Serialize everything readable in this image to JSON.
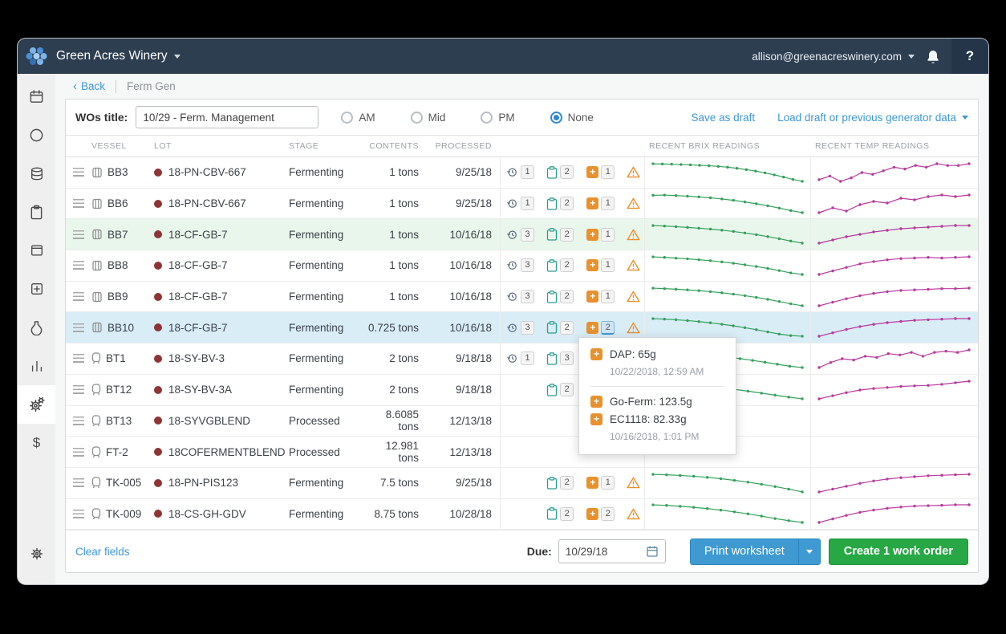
{
  "colors": {
    "navbar_bg": "#2d3e50",
    "link_blue": "#3e97d3",
    "brix_line": "#33a05a",
    "temp_line": "#b93a9e",
    "addition_orange": "#e8912d",
    "warning_orange": "#e8912d",
    "lot_dot": "#8e3434",
    "print_button_blue": "#3f9ad2",
    "create_button_green": "#28a745",
    "row_highlight_green": "#e9f6ec",
    "row_highlight_blue": "#d9edf7"
  },
  "navbar": {
    "title": "Green Acres Winery",
    "user_email": "allison@greenacreswinery.com",
    "help_label": "?"
  },
  "sidebar": {
    "items": [
      {
        "name": "calendar",
        "active": false
      },
      {
        "name": "circle",
        "active": false
      },
      {
        "name": "tanks",
        "active": false
      },
      {
        "name": "clipboard",
        "active": false
      },
      {
        "name": "bin",
        "active": false
      },
      {
        "name": "add",
        "active": false
      },
      {
        "name": "carboy",
        "active": false
      },
      {
        "name": "chart",
        "active": false
      },
      {
        "name": "gears",
        "active": true
      },
      {
        "name": "dollar",
        "active": false
      },
      {
        "name": "settings",
        "active": false,
        "bottom": true
      }
    ]
  },
  "breadcrumb": {
    "back_label": "Back",
    "page_label": "Ferm Gen"
  },
  "form": {
    "wos_title_label": "WOs title:",
    "wos_title_value": "10/29 - Ferm. Management",
    "radios": [
      {
        "label": "AM",
        "selected": false
      },
      {
        "label": "Mid",
        "selected": false
      },
      {
        "label": "PM",
        "selected": false
      },
      {
        "label": "None",
        "selected": true
      }
    ],
    "save_as_draft_label": "Save as draft",
    "load_draft_label": "Load draft or previous generator data"
  },
  "table": {
    "headers": {
      "vessel": "VESSEL",
      "lot": "LOT",
      "stage": "STAGE",
      "contents": "CONTENTS",
      "processed": "PROCESSED",
      "brix": "RECENT BRIX READINGS",
      "temp": "RECENT TEMP READINGS"
    },
    "rows": [
      {
        "vessel": "BB3",
        "vessel_icon": "barrel",
        "lot": "18-PN-CBV-667",
        "stage": "Fermenting",
        "contents": "1 tons",
        "processed": "9/25/18",
        "history": 1,
        "notes": 2,
        "additions": 1,
        "additions_active": false,
        "warning": true,
        "highlight": "",
        "brix": [
          23.8,
          23.6,
          23.4,
          23.1,
          22.8,
          22.4,
          22,
          21.4,
          20.6,
          19.6,
          18.4,
          17,
          15.4,
          13.6,
          11.6,
          9.4,
          7.6
        ],
        "temp": [
          66,
          68,
          65,
          67,
          70,
          69,
          71,
          73,
          72,
          74,
          73,
          75,
          74,
          74,
          75
        ]
      },
      {
        "vessel": "BB6",
        "vessel_icon": "barrel",
        "lot": "18-PN-CBV-667",
        "stage": "Fermenting",
        "contents": "1 tons",
        "processed": "9/25/18",
        "history": 1,
        "notes": 2,
        "additions": 1,
        "additions_active": false,
        "warning": true,
        "highlight": "",
        "brix": [
          22.6,
          22.8,
          22.3,
          21.8,
          21.2,
          20.4,
          19.4,
          18.2,
          16.8,
          15.2,
          13.4,
          11.4,
          9.2,
          7.4
        ],
        "temp": [
          63,
          66,
          64,
          68,
          70,
          69,
          72,
          71,
          73,
          74,
          73,
          74
        ]
      },
      {
        "vessel": "BB7",
        "vessel_icon": "barrel",
        "lot": "18-CF-GB-7",
        "stage": "Fermenting",
        "contents": "1 tons",
        "processed": "10/16/18",
        "history": 3,
        "notes": 2,
        "additions": 1,
        "additions_active": false,
        "warning": true,
        "highlight": "green",
        "brix": [
          21.5,
          21,
          20.4,
          19.7,
          18.9,
          18,
          16.9,
          15.6,
          14.1,
          12.4,
          10.5,
          8.4,
          6.1,
          4
        ],
        "temp": [
          60,
          62,
          64,
          65.5,
          67,
          68,
          69,
          69.5,
          70,
          70.5,
          71,
          71
        ]
      },
      {
        "vessel": "BB8",
        "vessel_icon": "barrel",
        "lot": "18-CF-GB-7",
        "stage": "Fermenting",
        "contents": "1 tons",
        "processed": "10/16/18",
        "history": 3,
        "notes": 2,
        "additions": 1,
        "additions_active": false,
        "warning": true,
        "highlight": "",
        "brix": [
          21.8,
          21.2,
          20.5,
          19.7,
          18.8,
          17.8,
          16.6,
          15.2,
          13.6,
          11.8,
          9.8,
          7.6,
          5.2,
          3.6
        ],
        "temp": [
          58,
          61,
          64,
          67,
          69,
          70.5,
          71.5,
          72,
          72.5,
          72,
          72.5,
          73
        ]
      },
      {
        "vessel": "BB9",
        "vessel_icon": "barrel",
        "lot": "18-CF-GB-7",
        "stage": "Fermenting",
        "contents": "1 tons",
        "processed": "10/16/18",
        "history": 3,
        "notes": 2,
        "additions": 1,
        "additions_active": false,
        "warning": true,
        "highlight": "",
        "brix": [
          22.4,
          21.9,
          21.3,
          20.6,
          19.8,
          18.8,
          17.6,
          16.2,
          14.6,
          12.8,
          10.8,
          8.6,
          6.2,
          4.2
        ],
        "temp": [
          59,
          62,
          65,
          67.5,
          69.5,
          71,
          72,
          72.5,
          73,
          73.5,
          73.5,
          74
        ]
      },
      {
        "vessel": "BB10",
        "vessel_icon": "barrel",
        "lot": "18-CF-GB-7",
        "stage": "Fermenting",
        "contents": "0.725 tons",
        "processed": "10/16/18",
        "history": 3,
        "notes": 2,
        "additions": 2,
        "additions_active": true,
        "warning": true,
        "highlight": "blue",
        "brix": [
          20.6,
          20.1,
          19.5,
          18.7,
          17.7,
          16.5,
          15.1,
          13.5,
          11.7,
          9.7,
          7.5,
          5.3,
          3.8,
          3.2
        ],
        "temp": [
          57,
          60,
          63,
          65.5,
          67.5,
          69,
          70,
          71,
          71.5,
          72,
          72.5,
          72.5
        ]
      },
      {
        "vessel": "BT1",
        "vessel_icon": "tank",
        "lot": "18-SY-BV-3",
        "stage": "Fermenting",
        "contents": "2 tons",
        "processed": "9/18/18",
        "history": 1,
        "notes": 3,
        "additions": null,
        "additions_active": false,
        "warning": false,
        "highlight": "",
        "brix": [
          18.5,
          17.8,
          17,
          16.1,
          15.1,
          14,
          12.8,
          11.5,
          10.1,
          8.6,
          7,
          5.4,
          4.4
        ],
        "temp": [
          62,
          66,
          69,
          68,
          71,
          70,
          73,
          72,
          74,
          71,
          74,
          75,
          74,
          76
        ]
      },
      {
        "vessel": "BT12",
        "vessel_icon": "tank",
        "lot": "18-SY-BV-3A",
        "stage": "Fermenting",
        "contents": "2 tons",
        "processed": "9/18/18",
        "history": null,
        "notes": 2,
        "additions": null,
        "additions_active": false,
        "warning": false,
        "highlight": "",
        "brix": [
          16.4,
          15.7,
          14.9,
          14,
          13,
          11.9,
          10.7,
          9.4,
          8,
          6.6,
          5.2,
          4
        ],
        "temp": [
          60,
          63,
          66,
          68.5,
          70,
          71,
          72,
          72.5,
          73,
          74,
          75.5,
          77
        ]
      },
      {
        "vessel": "BT13",
        "vessel_icon": "tank",
        "lot": "18-SYVGBLEND",
        "stage": "Processed",
        "contents": "8.6085 tons",
        "processed": "12/13/18",
        "history": null,
        "notes": null,
        "additions": null,
        "additions_active": false,
        "warning": false,
        "highlight": "",
        "brix": [],
        "temp": []
      },
      {
        "vessel": "FT-2",
        "vessel_icon": "tank",
        "lot": "18COFERMENTBLEND",
        "stage": "Processed",
        "contents": "12.981 tons",
        "processed": "12/13/18",
        "history": null,
        "notes": null,
        "additions": null,
        "additions_active": false,
        "warning": false,
        "highlight": "",
        "brix": [],
        "temp": []
      },
      {
        "vessel": "TK-005",
        "vessel_icon": "tank",
        "lot": "18-PN-PIS123",
        "stage": "Fermenting",
        "contents": "7.5 tons",
        "processed": "9/25/18",
        "history": null,
        "notes": 2,
        "additions": 1,
        "additions_active": false,
        "warning": true,
        "highlight": "",
        "brix": [
          19.2,
          18.8,
          18.3,
          17.6,
          16.7,
          15.6,
          14.3,
          12.8,
          11.1,
          9.2,
          7.1,
          4.8
        ],
        "temp": [
          56,
          59,
          62,
          65,
          67.5,
          69.5,
          71,
          72,
          73,
          73.5,
          74,
          74.5
        ]
      },
      {
        "vessel": "TK-009",
        "vessel_icon": "tank",
        "lot": "18-CS-GH-GDV",
        "stage": "Fermenting",
        "contents": "8.75 tons",
        "processed": "10/28/18",
        "history": null,
        "notes": 2,
        "additions": 2,
        "additions_active": false,
        "warning": true,
        "highlight": "",
        "brix": [
          18.4,
          17.9,
          17.2,
          16.3,
          15.2,
          13.9,
          12.4,
          10.7,
          8.8,
          6.7,
          4.9,
          3.4
        ],
        "temp": [
          55,
          59,
          63,
          66.5,
          69,
          71,
          72.5,
          73.5,
          74,
          74.5,
          75,
          75
        ]
      }
    ]
  },
  "popover": {
    "groups": [
      {
        "items": [
          "DAP: 65g"
        ],
        "timestamp": "10/22/2018, 12:59 AM"
      },
      {
        "items": [
          "Go-Ferm: 123.5g",
          "EC1118: 82.33g"
        ],
        "timestamp": "10/16/2018, 1:01 PM"
      }
    ]
  },
  "footer": {
    "clear_fields_label": "Clear fields",
    "due_label": "Due:",
    "due_value": "10/29/18",
    "print_worksheet_label": "Print worksheet",
    "create_work_order_label": "Create 1 work order"
  }
}
